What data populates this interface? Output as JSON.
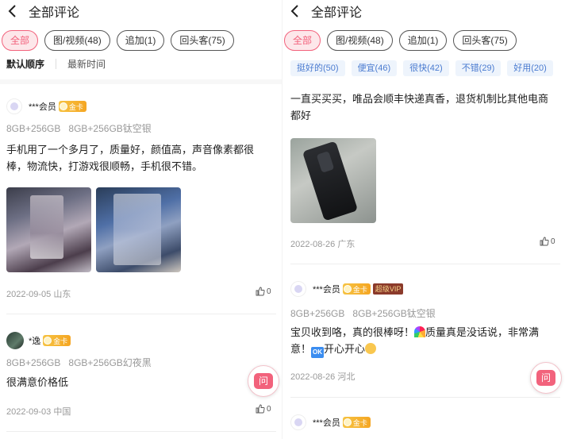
{
  "page_title": "全部评论",
  "filter_tabs": [
    "全部",
    "图/视频(48)",
    "追加(1)",
    "回头客(75)"
  ],
  "sort_options": [
    "默认顺序",
    "最新时间"
  ],
  "tag_chips": [
    "挺好的(50)",
    "便宜(46)",
    "很快(42)",
    "不错(29)",
    "好用(20)"
  ],
  "ask_label": "问",
  "left_reviews": [
    {
      "user": "***会员",
      "badge": "金卡",
      "spec1": "8GB+256GB",
      "spec2": "8GB+256GB钛空银",
      "text": "手机用了一个多月了，质量好，颜值高，声音像素都很棒，物流快，打游戏很顺畅，手机很不错。",
      "date": "2022-09-05 山东",
      "likes": "0"
    },
    {
      "user": "*逸",
      "badge": "金卡",
      "spec1": "8GB+256GB",
      "spec2": "8GB+256GB幻夜黑",
      "text": "很满意价格低",
      "date": "2022-09-03 中国",
      "likes": "0"
    }
  ],
  "right_reviews": [
    {
      "text": "一直买买买，唯品会顺丰快递真香，退货机制比其他电商都好",
      "date": "2022-08-26 广东",
      "likes": "0"
    },
    {
      "user": "***会员",
      "badge": "金卡",
      "vip": "超级VIP",
      "spec1": "8GB+256GB",
      "spec2": "8GB+256GB钛空银",
      "text_a": "宝贝收到咯，真的很棒呀！",
      "text_b": "质量真是没话说，非常满意！",
      "text_c": "开心开心",
      "date": "2022-08-26 河北"
    },
    {
      "user": "***会员",
      "badge": "金卡"
    }
  ],
  "colors": {
    "accent": "#f2627c",
    "chip_text": "#4a7bd0",
    "gold": "#f5a623"
  }
}
